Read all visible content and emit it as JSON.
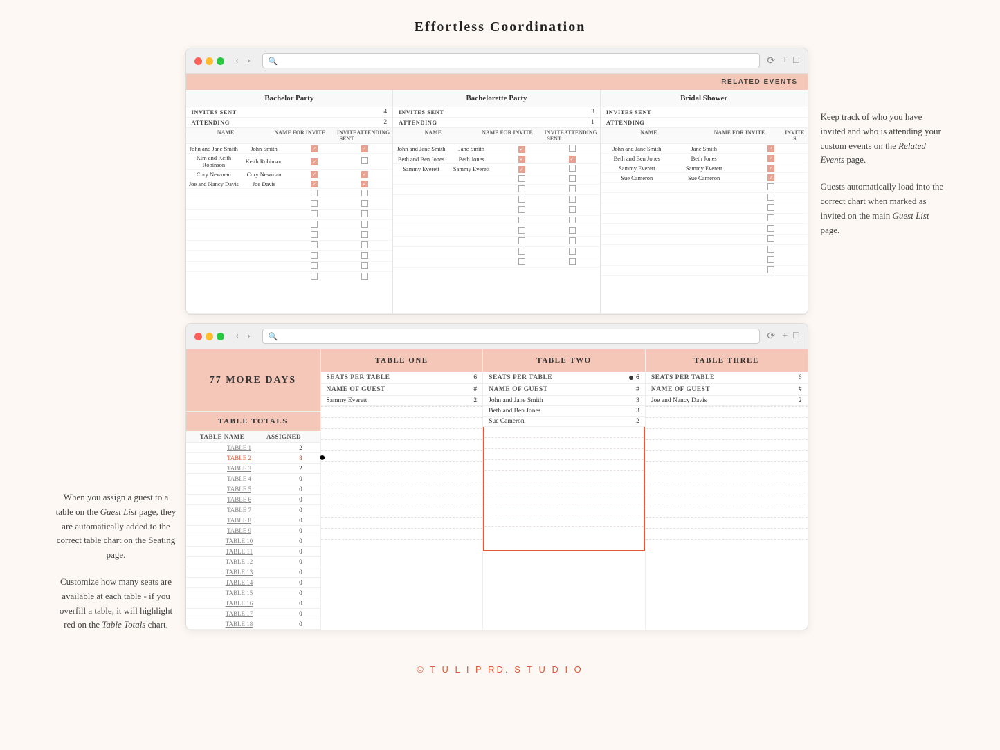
{
  "page": {
    "title": "Effortless Coordination",
    "footer": "© T U L I P RD. S T U D I O"
  },
  "right_text": {
    "para1": "Keep track of who you have invited and who is attending your custom events on the",
    "para1_em": "Related Events",
    "para1_end": "page.",
    "para2_start": "Guests automatically load into the correct chart when marked as invited on the main",
    "para2_em": "Guest List",
    "para2_end": "page."
  },
  "left_text": {
    "para1_start": "When you assign a guest to a table on the",
    "para1_em": "Guest List",
    "para1_end": "page, they are automatically added to the correct table chart on the Seating page.",
    "para2_start": "Customize how many seats are available at each table - if you overfill a table, it will highlight red on the",
    "para2_em": "Table Totals",
    "para2_end": "chart."
  },
  "browser1": {
    "related_events_label": "RELATED EVENTS",
    "events": [
      {
        "title": "Bachelor Party",
        "invites_sent_label": "INVITES SENT",
        "invites_sent_value": "4",
        "attending_label": "ATTENDING",
        "attending_value": "2",
        "col_headers": [
          "NAME",
          "NAME FOR INVITE",
          "INVITE SENT",
          "ATTENDING"
        ],
        "rows": [
          {
            "name": "John and Jane Smith",
            "invite_name": "John Smith",
            "invite_sent": true,
            "attending": true
          },
          {
            "name": "Kim and Keith Robinson",
            "invite_name": "Keith Robinson",
            "invite_sent": true,
            "attending": false
          },
          {
            "name": "Cory Newman",
            "invite_name": "Cory Newman",
            "invite_sent": true,
            "attending": false
          },
          {
            "name": "Joe and Nancy Davis",
            "invite_name": "Joe Davis",
            "invite_sent": true,
            "attending": true
          }
        ]
      },
      {
        "title": "Bachelorette Party",
        "invites_sent_label": "INVITES SENT",
        "invites_sent_value": "3",
        "attending_label": "ATTENDING",
        "attending_value": "1",
        "col_headers": [
          "NAME",
          "NAME FOR INVITE",
          "INVITE SENT",
          "ATTENDING"
        ],
        "rows": [
          {
            "name": "John and Jane Smith",
            "invite_name": "Jane Smith",
            "invite_sent": true,
            "attending": false
          },
          {
            "name": "Beth and Ben Jones",
            "invite_name": "Beth Jones",
            "invite_sent": true,
            "attending": true
          },
          {
            "name": "Sammy Everett",
            "invite_name": "Sammy Everett",
            "invite_sent": true,
            "attending": false
          }
        ]
      },
      {
        "title": "Bridal Shower",
        "invites_sent_label": "INVITES SENT",
        "invites_sent_value": "",
        "attending_label": "ATTENDING",
        "attending_value": "",
        "col_headers": [
          "NAME",
          "NAME FOR INVITE",
          "INVITE S"
        ],
        "rows": [
          {
            "name": "John and Jane Smith",
            "invite_name": "Jane Smith",
            "invite_sent": true,
            "attending": false
          },
          {
            "name": "Beth and Ben Jones",
            "invite_name": "Beth Jones",
            "invite_sent": true,
            "attending": false
          },
          {
            "name": "Sammy Everett",
            "invite_name": "Sammy Everett",
            "invite_sent": true,
            "attending": false
          },
          {
            "name": "Sue Cameron",
            "invite_name": "Sue Cameron",
            "invite_sent": true,
            "attending": false
          }
        ]
      }
    ]
  },
  "browser2": {
    "countdown": "77 MORE DAYS",
    "table_totals": {
      "title": "TABLE TOTALS",
      "col1": "TABLE NAME",
      "col2": "ASSIGNED",
      "rows": [
        {
          "name": "TABLE 1",
          "assigned": "2",
          "highlighted": false
        },
        {
          "name": "TABLE 2",
          "assigned": "8",
          "highlighted": true
        },
        {
          "name": "TABLE 3",
          "assigned": "2",
          "highlighted": false
        },
        {
          "name": "TABLE 4",
          "assigned": "0",
          "highlighted": false
        },
        {
          "name": "TABLE 5",
          "assigned": "0",
          "highlighted": false
        },
        {
          "name": "TABLE 6",
          "assigned": "0",
          "highlighted": false
        },
        {
          "name": "TABLE 7",
          "assigned": "0",
          "highlighted": false
        },
        {
          "name": "TABLE 8",
          "assigned": "0",
          "highlighted": false
        },
        {
          "name": "TABLE 9",
          "assigned": "0",
          "highlighted": false
        },
        {
          "name": "TABLE 10",
          "assigned": "0",
          "highlighted": false
        },
        {
          "name": "TABLE 11",
          "assigned": "0",
          "highlighted": false
        },
        {
          "name": "TABLE 12",
          "assigned": "0",
          "highlighted": false
        },
        {
          "name": "TABLE 13",
          "assigned": "0",
          "highlighted": false
        },
        {
          "name": "TABLE 14",
          "assigned": "0",
          "highlighted": false
        },
        {
          "name": "TABLE 15",
          "assigned": "0",
          "highlighted": false
        },
        {
          "name": "TABLE 16",
          "assigned": "0",
          "highlighted": false
        },
        {
          "name": "TABLE 17",
          "assigned": "0",
          "highlighted": false
        },
        {
          "name": "TABLE 18",
          "assigned": "0",
          "highlighted": false
        }
      ]
    },
    "seat_tables": [
      {
        "title": "TABLE ONE",
        "seats_per_table_label": "SEATS PER TABLE",
        "seats_per_table_value": "6",
        "name_of_guest_label": "NAME OF GUEST",
        "name_of_guest_col": "#",
        "guests": [
          {
            "name": "Sammy Everett",
            "num": "2"
          }
        ]
      },
      {
        "title": "TABLE TWO",
        "seats_per_table_label": "SEATS PER TABLE",
        "seats_per_table_value": "6",
        "name_of_guest_label": "NAME OF GUEST",
        "name_of_guest_col": "#",
        "guests": [
          {
            "name": "John and Jane Smith",
            "num": "3"
          },
          {
            "name": "Beth and Ben Jones",
            "num": "3"
          },
          {
            "name": "Sue Cameron",
            "num": "2"
          }
        ]
      },
      {
        "title": "TABLE THREE",
        "seats_per_table_label": "SEATS PER TABLE",
        "seats_per_table_value": "6",
        "name_of_guest_label": "NAME OF GUEST",
        "name_of_guest_col": "#",
        "guests": [
          {
            "name": "Joe and Nancy Davis",
            "num": "2"
          }
        ]
      }
    ]
  }
}
